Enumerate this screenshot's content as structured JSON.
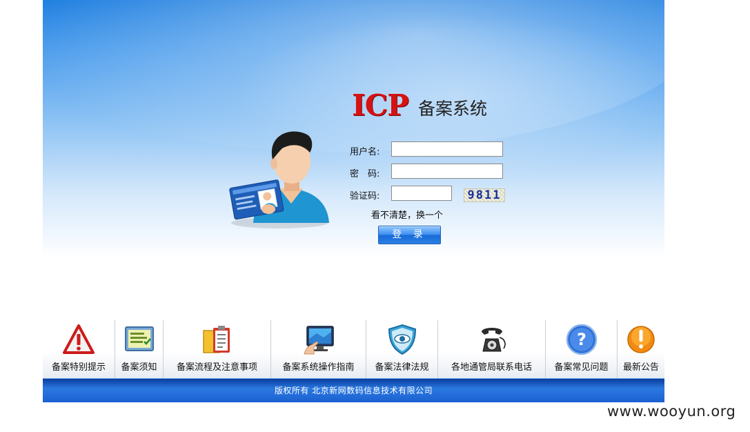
{
  "logo": {
    "icp": "ICP",
    "subtitle": "备案系统"
  },
  "form": {
    "username_label": "用户名:",
    "password_label": "密　码:",
    "captcha_label": "验证码:",
    "username_value": "",
    "password_value": "",
    "captcha_value": "",
    "captcha_image_text": "9811",
    "refresh_text": "看不清楚，换一个",
    "login_label": "登 录"
  },
  "nav": {
    "items": [
      {
        "label": "备案特别提示",
        "icon": "warning-icon"
      },
      {
        "label": "备案须知",
        "icon": "notice-board-icon"
      },
      {
        "label": "备案流程及注意事项",
        "icon": "clipboard-folder-icon"
      },
      {
        "label": "备案系统操作指南",
        "icon": "monitor-hand-icon"
      },
      {
        "label": "备案法律法规",
        "icon": "shield-eye-icon"
      },
      {
        "label": "各地通管局联系电话",
        "icon": "telephone-icon"
      },
      {
        "label": "备案常见问题",
        "icon": "question-icon"
      },
      {
        "label": "最新公告",
        "icon": "exclamation-icon"
      }
    ]
  },
  "footer": {
    "text": "版权所有 北京新网数码信息技术有限公司"
  },
  "watermark": "www.wooyun.org",
  "colors": {
    "logo_red": "#d51313",
    "button_blue": "#2d80e6",
    "footer_blue": "#1a5fd0"
  }
}
